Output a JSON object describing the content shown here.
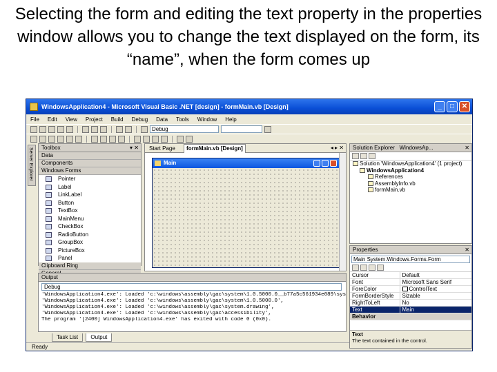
{
  "slide": {
    "title": "Selecting the form and editing the text property in the properties window allows you to change the text displayed on the form, its “name”, when the form comes up"
  },
  "window": {
    "title": "WindowsApplication4 - Microsoft Visual Basic .NET [design] - formMain.vb [Design]",
    "controls": [
      "_",
      "□",
      "✕"
    ]
  },
  "menu": [
    "File",
    "Edit",
    "View",
    "Project",
    "Build",
    "Debug",
    "Data",
    "Tools",
    "Window",
    "Help"
  ],
  "toolbar": {
    "config": "Debug"
  },
  "sidebar": {
    "server_explorer": "Server Explorer"
  },
  "toolbox": {
    "title": "Toolbox",
    "sections": [
      "Data",
      "Components",
      "Windows Forms"
    ],
    "items": [
      "Pointer",
      "Label",
      "LinkLabel",
      "Button",
      "TextBox",
      "MainMenu",
      "CheckBox",
      "RadioButton",
      "GroupBox",
      "PictureBox",
      "Panel"
    ],
    "footer_sections": [
      "Clipboard Ring",
      "General"
    ],
    "controls": "▾ ✕"
  },
  "designer": {
    "tabs": [
      "Start Page",
      "formMain.vb [Design]"
    ],
    "controls": "◂ ▸ ✕",
    "form_title": "Main"
  },
  "output": {
    "title": "Output",
    "pane": "Debug",
    "lines": [
      "'WindowsApplication4.exe': Loaded 'c:\\windows\\assembly\\gac\\system\\1.0.5000.0__b77a5c561934e089\\system.dll', No symbols loaded.",
      "'WindowsApplication4.exe': Loaded 'c:\\windows\\assembly\\gac\\system\\1.0.5000.0',",
      "'WindowsApplication4.exe': Loaded 'c:\\windows\\assembly\\gac\\system.drawing',",
      "'WindowsApplication4.exe': Loaded 'c:\\windows\\assembly\\gac\\accessibility',",
      "The program '[2400] WindowsApplication4.exe' has exited with code 0 (0x0)."
    ],
    "bottom_tabs": [
      "Task List",
      "Output"
    ]
  },
  "status": {
    "text": "Ready"
  },
  "solution_explorer": {
    "tabs": [
      "Solution Explorer",
      "WindowsAp..."
    ],
    "controls": "✕",
    "items": [
      "Solution 'WindowsApplication4' (1 project)",
      "WindowsApplication4",
      "References",
      "AssemblyInfo.vb",
      "formMain.vb"
    ]
  },
  "properties": {
    "title": "Properties",
    "controls": "✕",
    "object": "Main  System.Windows.Forms.Form",
    "rows": [
      {
        "name": "Cursor",
        "value": "Default"
      },
      {
        "name": "Font",
        "value": "Microsoft Sans Serif"
      },
      {
        "name": "ForeColor",
        "value": "ControlText"
      },
      {
        "name": "FormBorderStyle",
        "value": "Sizable"
      },
      {
        "name": "RightToLeft",
        "value": "No"
      },
      {
        "name": "Text",
        "value": "Main"
      }
    ],
    "category": "Behavior",
    "desc_title": "Text",
    "desc_text": "The text contained in the control."
  }
}
